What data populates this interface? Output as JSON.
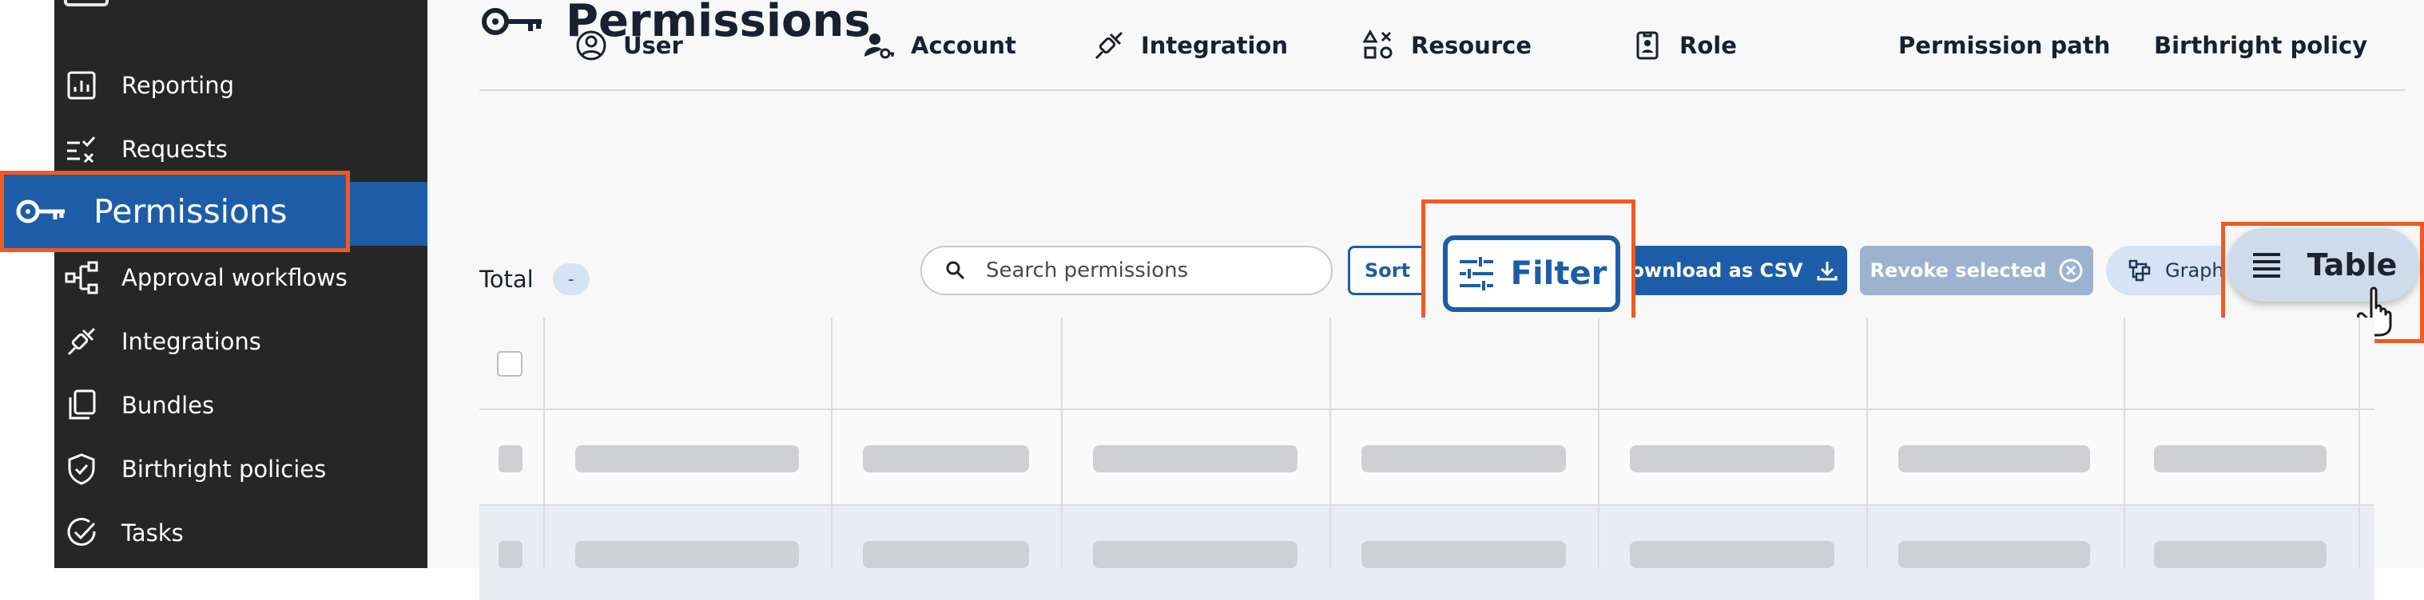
{
  "sidebar": {
    "items": [
      {
        "label": "Reporting",
        "icon": "bar-chart-icon"
      },
      {
        "label": "Requests",
        "icon": "checklist-icon"
      },
      {
        "label": "Permissions",
        "icon": "key-icon",
        "active": true
      },
      {
        "label": "Approval workflows",
        "icon": "workflow-icon"
      },
      {
        "label": "Integrations",
        "icon": "plug-icon"
      },
      {
        "label": "Bundles",
        "icon": "copy-icon"
      },
      {
        "label": "Birthright policies",
        "icon": "shield-check-icon"
      },
      {
        "label": "Tasks",
        "icon": "check-circle-icon"
      }
    ]
  },
  "header": {
    "title": "Permissions",
    "icon": "key-icon"
  },
  "toolbar": {
    "total_label": "Total",
    "total_value": "-",
    "search_placeholder": "Search permissions",
    "sort_label": "Sort",
    "filter_label": "Filter",
    "download_label": "Download as CSV",
    "revoke_label": "Revoke selected",
    "graph_label": "Graph",
    "table_label": "Table"
  },
  "table": {
    "columns": [
      {
        "label": "User",
        "icon": "user-circle-icon"
      },
      {
        "label": "Account",
        "icon": "account-key-icon"
      },
      {
        "label": "Integration",
        "icon": "plug-icon"
      },
      {
        "label": "Resource",
        "icon": "shapes-icon"
      },
      {
        "label": "Role",
        "icon": "badge-icon"
      },
      {
        "label": "Permission path",
        "icon": ""
      },
      {
        "label": "Birthright policy",
        "icon": ""
      }
    ],
    "state": "loading"
  },
  "colors": {
    "sidebar_bg": "#262626",
    "accent": "#1d5da8",
    "highlight": "#f05a22"
  }
}
